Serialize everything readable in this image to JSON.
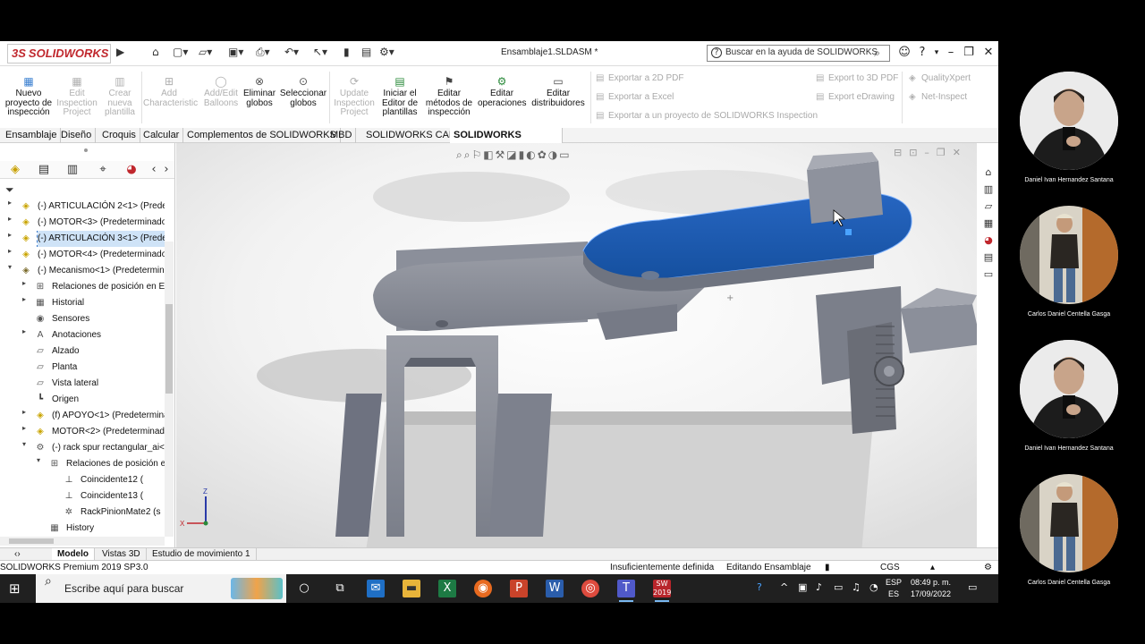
{
  "app": {
    "brand": "SOLIDWORKS",
    "document_title": "Ensamblaje1.SLDASM *",
    "help_search_placeholder": "Buscar en la ayuda de SOLIDWORKS"
  },
  "ribbon": {
    "buttons": [
      {
        "label": "Nuevo proyecto de inspección",
        "enabled": true
      },
      {
        "label": "Edit Inspection Project",
        "enabled": false
      },
      {
        "label": "Crear nueva plantilla",
        "enabled": false
      },
      {
        "label": "Add Characteristic",
        "enabled": false
      },
      {
        "label": "Add/Edit Balloons",
        "enabled": false
      },
      {
        "label": "Eliminar globos",
        "enabled": true
      },
      {
        "label": "Seleccionar globos",
        "enabled": true
      },
      {
        "label": "Update Inspection Project",
        "enabled": false
      },
      {
        "label": "Iniciar el Editor de plantillas",
        "enabled": true
      },
      {
        "label": "Editar métodos de inspección",
        "enabled": true
      },
      {
        "label": "Editar operaciones",
        "enabled": true
      },
      {
        "label": "Editar distribuidores",
        "enabled": true
      }
    ],
    "export_items": [
      "Exportar a 2D PDF",
      "Exportar a Excel",
      "Exportar a un proyecto de SOLIDWORKS Inspection"
    ],
    "export_items_right": [
      "Export to 3D PDF",
      "Export eDrawing"
    ],
    "quality_items": [
      "QualityXpert",
      "Net-Inspect"
    ]
  },
  "command_tabs": [
    "Ensamblaje",
    "Diseño",
    "Croquis",
    "Calcular",
    "Complementos de SOLIDWORKS",
    "MBD",
    "SOLIDWORKS CAM",
    "SOLIDWORKS Inspection"
  ],
  "active_tab": "SOLIDWORKS Inspection",
  "feature_tree": [
    {
      "label": "(-) ARTICULACIÓN 2<1> (Predete",
      "icon": "part",
      "expander": "▸",
      "level": 0
    },
    {
      "label": "(-) MOTOR<3> (Predeterminado<",
      "icon": "part",
      "expander": "▸",
      "level": 0
    },
    {
      "label": "(-) ARTICULACIÓN 3<1> (Predete",
      "icon": "part",
      "expander": "▸",
      "level": 0,
      "selected": true
    },
    {
      "label": "(-) MOTOR<4> (Predeterminado<",
      "icon": "part",
      "expander": "▸",
      "level": 0
    },
    {
      "label": "(-) Mecanismo<1> (Predetermina",
      "icon": "assembly",
      "expander": "▾",
      "level": 0
    },
    {
      "label": "Relaciones de posición en En",
      "icon": "mates",
      "expander": "▸",
      "level": 1
    },
    {
      "label": "Historial",
      "icon": "history",
      "expander": "▸",
      "level": 1
    },
    {
      "label": "Sensores",
      "icon": "sensor",
      "expander": "",
      "level": 1
    },
    {
      "label": "Anotaciones",
      "icon": "annotation",
      "expander": "▸",
      "level": 1
    },
    {
      "label": "Alzado",
      "icon": "plane",
      "expander": "",
      "level": 1
    },
    {
      "label": "Planta",
      "icon": "plane",
      "expander": "",
      "level": 1
    },
    {
      "label": "Vista lateral",
      "icon": "plane",
      "expander": "",
      "level": 1
    },
    {
      "label": "Origen",
      "icon": "origin",
      "expander": "",
      "level": 1
    },
    {
      "label": "(f) APOYO<1> (Predetermina",
      "icon": "part",
      "expander": "▸",
      "level": 1
    },
    {
      "label": "MOTOR<2> (Predeterminado",
      "icon": "part",
      "expander": "▸",
      "level": 1
    },
    {
      "label": "(-) rack spur rectangular_ai<1",
      "icon": "toolbox",
      "expander": "▾",
      "level": 1
    },
    {
      "label": "Relaciones de posición e",
      "icon": "mates",
      "expander": "▾",
      "level": 2
    },
    {
      "label": "Coincidente12 (",
      "icon": "coincident",
      "expander": "",
      "level": 3
    },
    {
      "label": "Coincidente13 (",
      "icon": "coincident",
      "expander": "",
      "level": 3
    },
    {
      "label": "RackPinionMate2 (s",
      "icon": "gear",
      "expander": "",
      "level": 3
    },
    {
      "label": "History",
      "icon": "history",
      "expander": "",
      "level": 2
    }
  ],
  "bottom_tabs": [
    "Modelo",
    "Vistas 3D",
    "Estudio de movimiento 1"
  ],
  "active_bottom_tab": "Modelo",
  "status_bar": {
    "product": "SOLIDWORKS Premium 2019 SP3.0",
    "definition": "Insuficientemente definida",
    "mode": "Editando Ensamblaje",
    "units": "CGS"
  },
  "triad": {
    "z": "Z",
    "x": "X"
  },
  "taskbar": {
    "search_placeholder": "Escribe aquí para buscar",
    "lang_line1": "ESP",
    "lang_line2": "ES",
    "time": "08:49 p. m.",
    "date": "17/09/2022",
    "app_badge": "2019"
  },
  "participants": [
    {
      "name": "Daniel Ivan Hernandez Santana"
    },
    {
      "name": "Carlos Daniel Centella Gasga"
    },
    {
      "name": "Daniel Ivan Hernandez Santana"
    },
    {
      "name": "Carlos Daniel Centella Gasga"
    }
  ],
  "colors": {
    "selected_part": "#1d5fb3",
    "part_gray": "#8b8f9a",
    "accent": "#c0272d"
  }
}
